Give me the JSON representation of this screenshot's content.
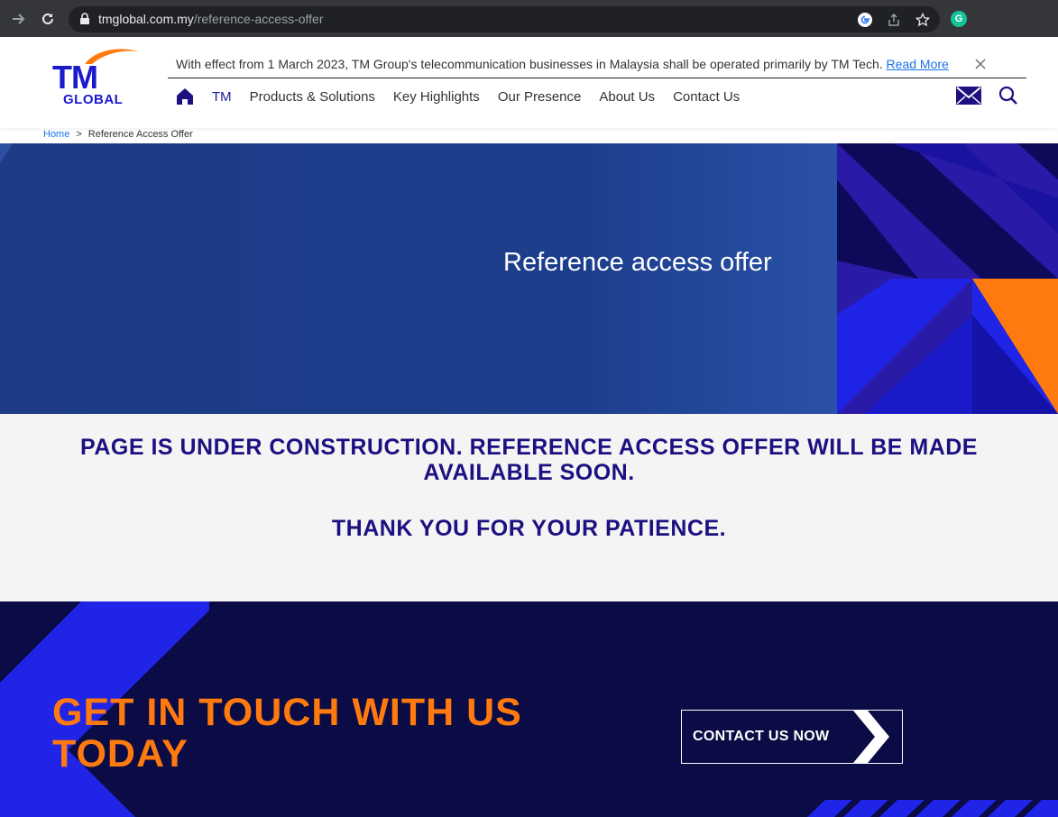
{
  "browser": {
    "url_host": "tmglobal.com.my",
    "url_path": "/reference-access-offer",
    "ext_badge": "G"
  },
  "header": {
    "logo_tm": "TM",
    "logo_global": "GLOBAL",
    "notice_text": "With effect from 1 March 2023, TM Group's telecommunication businesses in Malaysia shall be operated primarily by TM Tech.",
    "notice_link": "Read More",
    "nav": [
      "TM",
      "Products & Solutions",
      "Key Highlights",
      "Our Presence",
      "About Us",
      "Contact Us"
    ]
  },
  "breadcrumb": {
    "home": "Home",
    "separator": ">",
    "current": "Reference Access Offer"
  },
  "hero": {
    "title": "Reference access offer"
  },
  "band": {
    "message": "PAGE IS UNDER CONSTRUCTION. REFERENCE ACCESS OFFER WILL BE MADE AVAILABLE SOON.",
    "thanks": "THANK YOU FOR YOUR PATIENCE."
  },
  "cta": {
    "title": "GET IN TOUCH WITH US TODAY",
    "button": "CONTACT US NOW"
  },
  "colors": {
    "brand_blue": "#1a1acb",
    "navy": "#1d1080",
    "orange": "#ff7a0e",
    "footer_bg": "#0b0b45"
  }
}
